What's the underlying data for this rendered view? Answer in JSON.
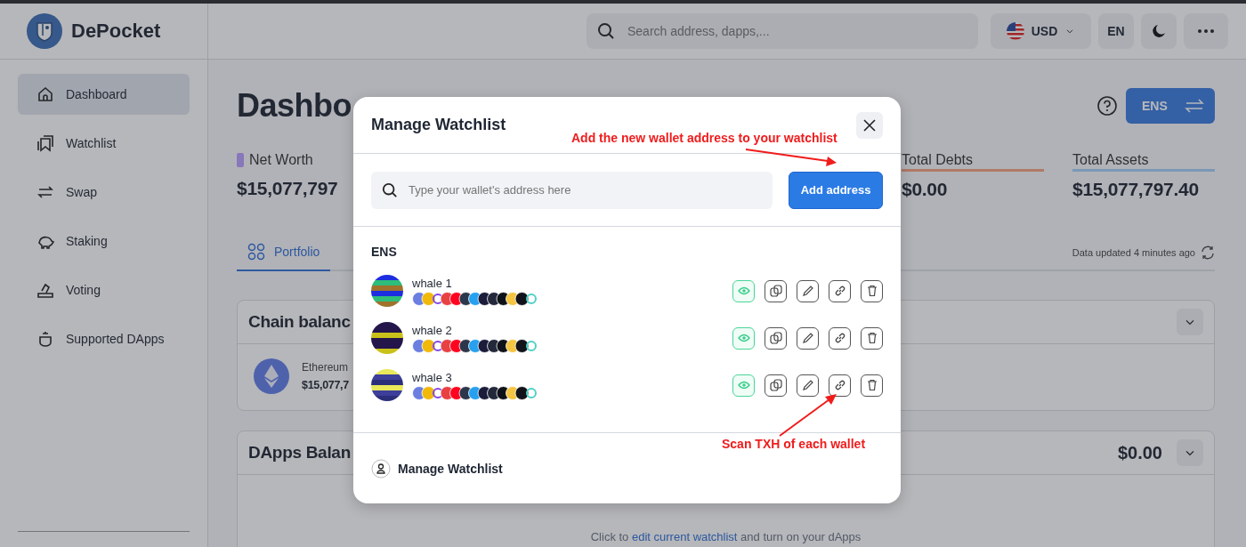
{
  "app": {
    "logo": "DePocket"
  },
  "header": {
    "search": {
      "placeholder": "Search address, dapps,..."
    },
    "currency": "USD",
    "language": "EN"
  },
  "sidebar": {
    "items": [
      {
        "label": "Dashboard",
        "selected": true
      },
      {
        "label": "Watchlist",
        "selected": false
      },
      {
        "label": "Swap",
        "selected": false
      },
      {
        "label": "Staking",
        "selected": false
      },
      {
        "label": "Voting",
        "selected": false
      },
      {
        "label": "Supported DApps",
        "selected": false
      }
    ]
  },
  "page": {
    "title": "Dashbo",
    "network_button": "ENS",
    "stats": [
      {
        "label": "Net Worth",
        "value": "$15,077,797",
        "kind": "marker",
        "color": "#8878c0"
      },
      {
        "label": "Total Debts",
        "value": "$0.00",
        "kind": "underline",
        "color": "#b07a68"
      },
      {
        "label": "Total Assets",
        "value": "$15,077,797.40",
        "kind": "underline",
        "color": "#7a98b8"
      }
    ],
    "tabs": [
      {
        "label": "Portfolio",
        "selected": true
      }
    ],
    "updated": "Data updated 4 minutes ago",
    "chain_card": {
      "title": "Chain balanc",
      "chains": [
        {
          "name": "Ethereum",
          "value": "$15,077,7"
        }
      ]
    },
    "dapps_card": {
      "title": "DApps Balan",
      "total": "$0.00",
      "hint_before": "Click to",
      "hint_link": "edit current watchlist",
      "hint_after": "and turn on your dApps"
    }
  },
  "modal": {
    "title": "Manage Watchlist",
    "search": {
      "placeholder": "Type your wallet's address here"
    },
    "add_button": "Add address",
    "group": "ENS",
    "wallets": [
      {
        "name": "whale 1",
        "watching": true
      },
      {
        "name": "whale 2",
        "watching": true
      },
      {
        "name": "whale 3",
        "watching": true
      }
    ],
    "footer": "Manage Watchlist"
  },
  "annotations": [
    {
      "text": "Add the new wallet address to your watchlist"
    },
    {
      "text": "Scan TXH of each wallet"
    }
  ]
}
